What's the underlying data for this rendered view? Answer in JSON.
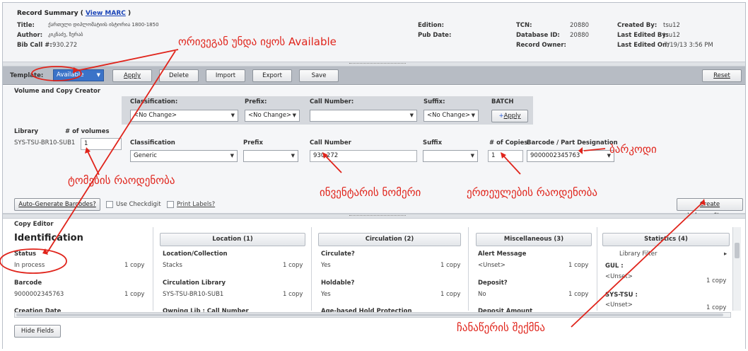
{
  "summary": {
    "title": "Record Summary (",
    "view_marc": "View MARC",
    "title_close": ")",
    "title_label": "Title:",
    "title_value": "ქართული დიპლომატიის ისტორია 1800-1850",
    "author_label": "Author:",
    "author_value": "კიკნაძე, ზურაბ",
    "bib_label": "Bib Call #:",
    "bib_value": "930.272",
    "edition_label": "Edition:",
    "pubdate_label": "Pub Date:",
    "tcn_label": "TCN:",
    "tcn_value": "20880",
    "dbid_label": "Database ID:",
    "dbid_value": "20880",
    "owner_label": "Record Owner:",
    "created_label": "Created By:",
    "created_value": "tsu12",
    "edited_label": "Last Edited By:",
    "edited_value": "tsu12",
    "editedon_label": "Last Edited On:",
    "editedon_value": "7/19/13 3:56 PM"
  },
  "toolbar": {
    "template_label": "Template:",
    "template_value": "Available",
    "apply": "Apply",
    "delete": "Delete",
    "import": "Import",
    "export": "Export",
    "save": "Save",
    "reset": "Reset"
  },
  "vcc": {
    "title": "Volume and Copy Creator",
    "batch": {
      "classification_label": "Classification:",
      "classification_value": "<No Change>",
      "prefix_label": "Prefix:",
      "prefix_value": "<No Change>",
      "call_number_label": "Call Number:",
      "call_number_value": "",
      "suffix_label": "Suffix:",
      "suffix_value": "<No Change>",
      "batch_label": "BATCH",
      "apply": "Apply"
    },
    "library_label": "Library",
    "library_value": "SYS-TSU-BR10-SUB1",
    "volumes_label": "# of volumes",
    "volumes_value": "1",
    "classification_label": "Classification",
    "classification_value": "Generic",
    "prefix_label": "Prefix",
    "prefix_value": "",
    "call_number_label": "Call Number",
    "call_number_value": "930.272",
    "suffix_label": "Suffix",
    "suffix_value": "",
    "copies_label": "# of Copies",
    "copies_value": "1",
    "barcode_label": "Barcode / Part Designation",
    "barcode_value": "9000002345763",
    "auto_barcodes": "Auto-Generate Barcodes?",
    "use_checkdigit": "Use Checkdigit",
    "print_labels": "Print Labels?",
    "create_button": "Create Volumes/Items"
  },
  "copy_editor": {
    "title": "Copy Editor",
    "heading": "Identification",
    "columns": {
      "location": "Location (1)",
      "circulation": "Circulation (2)",
      "misc": "Miscellaneous (3)",
      "stats": "Statistics (4)"
    },
    "ident": [
      {
        "label": "Status",
        "value": "In process",
        "count": "1 copy"
      },
      {
        "label": "Barcode",
        "value": "9000002345763",
        "count": "1 copy"
      },
      {
        "label": "Creation Date",
        "value": "",
        "count": ""
      }
    ],
    "location": [
      {
        "label": "Location/Collection",
        "value": "Stacks",
        "count": "1 copy"
      },
      {
        "label": "Circulation Library",
        "value": "SYS-TSU-BR10-SUB1",
        "count": "1 copy"
      },
      {
        "label": "Owning Lib : Call Number",
        "value": "",
        "count": ""
      }
    ],
    "circulation": [
      {
        "label": "Circulate?",
        "value": "Yes",
        "count": "1 copy"
      },
      {
        "label": "Holdable?",
        "value": "Yes",
        "count": "1 copy"
      },
      {
        "label": "Age-based Hold Protection",
        "value": "",
        "count": ""
      }
    ],
    "misc": [
      {
        "label": "Alert Message",
        "value": "<Unset>",
        "count": "1 copy"
      },
      {
        "label": "Deposit?",
        "value": "No",
        "count": "1 copy"
      },
      {
        "label": "Deposit Amount",
        "value": "",
        "count": ""
      }
    ],
    "stats": {
      "filter": "Library Filter",
      "gul_label": "GUL :",
      "gul_value": "<Unset>",
      "gul_count": "1 copy",
      "sys_label": "SYS-TSU :",
      "sys_value": "<Unset>",
      "sys_count": "1 copy"
    },
    "hide_fields": "Hide Fields"
  },
  "annotations": {
    "available": "ორივეგან უნდა იყოს Available",
    "volumes": "ტომების რაოდენობა",
    "inventory": "ინვენტარის ნომერი",
    "copies": "ერთეულების რაოდენობა",
    "barcode": "ბარკოდი",
    "create": "ჩანაწერის შექმნა"
  },
  "colors": {
    "annotation": "#e0241b",
    "link": "#1a44b8",
    "template_select": "#3b73c8"
  }
}
